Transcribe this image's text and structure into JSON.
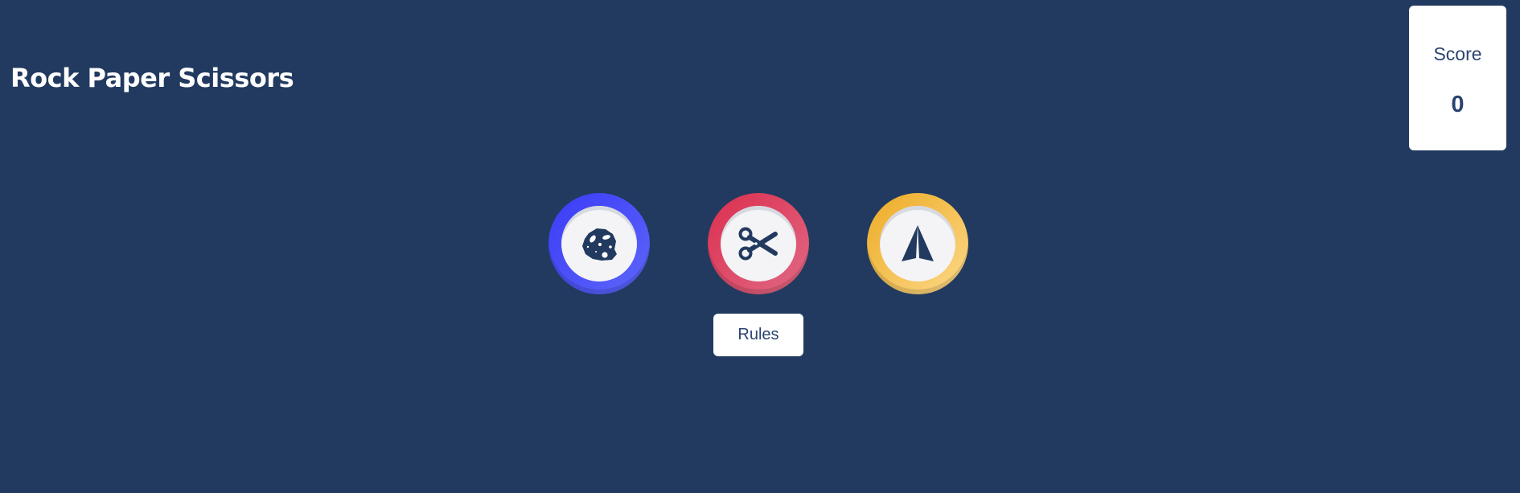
{
  "header": {
    "title": "Rock Paper Scissors"
  },
  "score": {
    "label": "Score",
    "value": "0"
  },
  "choices": [
    {
      "name": "rock",
      "icon": "rock-icon",
      "color": "#3b3bf7"
    },
    {
      "name": "scissors",
      "icon": "scissors-icon",
      "color": "#dc2e4e"
    },
    {
      "name": "paper",
      "icon": "paper-plane-icon",
      "color": "#ecab24"
    }
  ],
  "rules": {
    "label": "Rules"
  },
  "colors": {
    "background": "#223a5f",
    "text_dark": "#2a4470"
  }
}
